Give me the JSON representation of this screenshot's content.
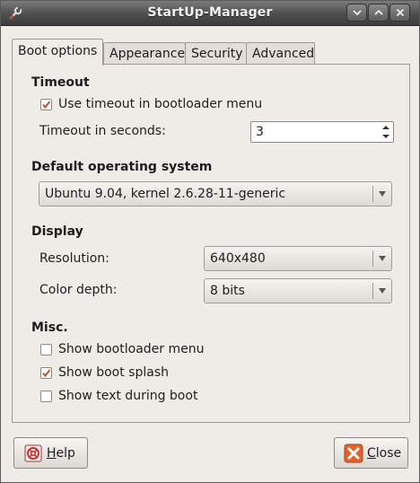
{
  "window": {
    "title": "StartUp-Manager"
  },
  "tabs": [
    {
      "label": "Boot options",
      "active": true
    },
    {
      "label": "Appearance",
      "active": false
    },
    {
      "label": "Security",
      "active": false
    },
    {
      "label": "Advanced",
      "active": false
    }
  ],
  "timeout": {
    "heading": "Timeout",
    "use_timeout_label": "Use timeout in bootloader menu",
    "use_timeout_checked": true,
    "seconds_label": "Timeout in seconds:",
    "seconds_value": "3"
  },
  "default_os": {
    "heading": "Default operating system",
    "selected": "Ubuntu 9.04, kernel 2.6.28-11-generic"
  },
  "display": {
    "heading": "Display",
    "resolution_label": "Resolution:",
    "resolution_value": "640x480",
    "color_depth_label": "Color depth:",
    "color_depth_value": "8 bits"
  },
  "misc": {
    "heading": "Misc.",
    "items": [
      {
        "label": "Show bootloader menu",
        "checked": false
      },
      {
        "label": "Show boot splash",
        "checked": true
      },
      {
        "label": "Show text during boot",
        "checked": false
      }
    ]
  },
  "buttons": {
    "help_first": "H",
    "help_rest": "elp",
    "close_first": "C",
    "close_rest": "lose"
  },
  "colors": {
    "accent": "#c0532a",
    "window_bg": "#efebe7",
    "titlebar": "#4e4e4e"
  }
}
